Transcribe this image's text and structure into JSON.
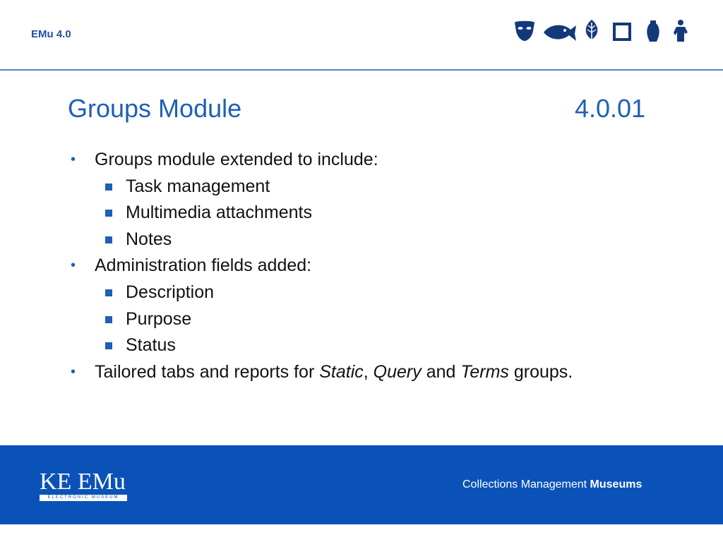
{
  "header": {
    "title": "EMu 4.0",
    "icons": [
      "mask-icon",
      "fish-icon",
      "leaf-icon",
      "frame-icon",
      "vase-icon",
      "statue-icon"
    ]
  },
  "slide": {
    "title": "Groups Module",
    "number": "4.0.01",
    "bullets": [
      {
        "text": "Groups module extended to include:",
        "sub": [
          "Task management",
          "Multimedia attachments",
          "Notes"
        ]
      },
      {
        "text": "Administration fields added:",
        "sub": [
          "Description",
          "Purpose",
          "Status"
        ]
      },
      {
        "parts": [
          {
            "text": "Tailored tabs and reports for ",
            "italic": false
          },
          {
            "text": "Static",
            "italic": true
          },
          {
            "text": ", ",
            "italic": false
          },
          {
            "text": "Query",
            "italic": true
          },
          {
            "text": " and ",
            "italic": false
          },
          {
            "text": "Terms",
            "italic": true
          },
          {
            "text": " groups.",
            "italic": false
          }
        ]
      }
    ]
  },
  "footer": {
    "logo_text": "KE EMu",
    "logo_subtext": "ELECTRONIC MUSEUM",
    "tagline_regular": "Collections Management ",
    "tagline_bold": "Museums"
  },
  "colors": {
    "accent_blue": "#1f5fb5",
    "footer_blue": "#0b52b8",
    "rule_blue": "#5a83c9",
    "icon_navy": "#123a7a"
  }
}
